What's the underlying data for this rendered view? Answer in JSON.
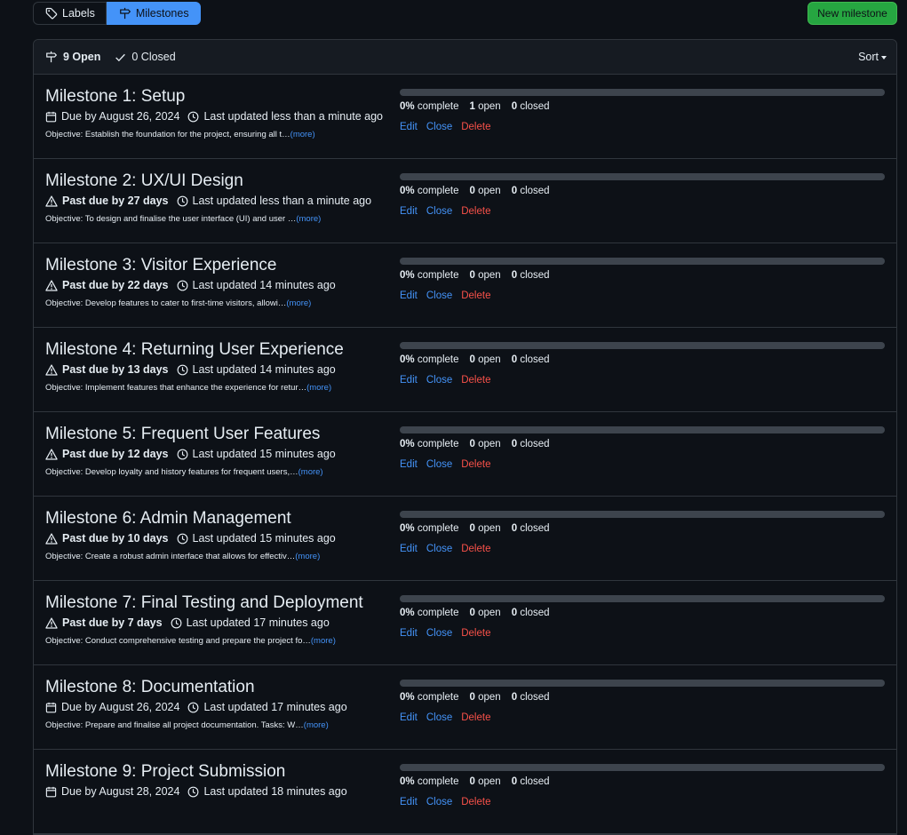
{
  "subnav": {
    "labels": "Labels",
    "milestones": "Milestones"
  },
  "new_milestone": "New milestone",
  "header": {
    "open_count": "9 Open",
    "closed_count": "0 Closed",
    "sort": "Sort"
  },
  "colors": {
    "accent": "#4493f8",
    "danger": "#f85149",
    "success": "#26a641"
  },
  "milestones": [
    {
      "title": "Milestone 1: Setup",
      "due_icon": "calendar-icon",
      "due_bold": "",
      "due_text": "Due by August 26, 2024",
      "updated": "Last updated less than a minute ago",
      "desc": "Objective: Establish the foundation for the project, ensuring all t…",
      "more": "(more)",
      "pct": "0%",
      "pct_label": "complete",
      "open": "1",
      "open_label": "open",
      "closed": "0",
      "closed_label": "closed",
      "progress": 0,
      "edit": "Edit",
      "close": "Close",
      "delete": "Delete"
    },
    {
      "title": "Milestone 2: UX/UI Design",
      "due_icon": "alert-icon",
      "due_bold": "Past due by 27 days",
      "due_text": "",
      "updated": "Last updated less than a minute ago",
      "desc": "Objective: To design and finalise the user interface (UI) and user …",
      "more": "(more)",
      "pct": "0%",
      "pct_label": "complete",
      "open": "0",
      "open_label": "open",
      "closed": "0",
      "closed_label": "closed",
      "progress": 0,
      "edit": "Edit",
      "close": "Close",
      "delete": "Delete"
    },
    {
      "title": "Milestone 3: Visitor Experience",
      "due_icon": "alert-icon",
      "due_bold": "Past due by 22 days",
      "due_text": "",
      "updated": "Last updated 14 minutes ago",
      "desc": "Objective: Develop features to cater to first-time visitors, allowi…",
      "more": "(more)",
      "pct": "0%",
      "pct_label": "complete",
      "open": "0",
      "open_label": "open",
      "closed": "0",
      "closed_label": "closed",
      "progress": 0,
      "edit": "Edit",
      "close": "Close",
      "delete": "Delete"
    },
    {
      "title": "Milestone 4: Returning User Experience",
      "due_icon": "alert-icon",
      "due_bold": "Past due by 13 days",
      "due_text": "",
      "updated": "Last updated 14 minutes ago",
      "desc": "Objective: Implement features that enhance the experience for retur…",
      "more": "(more)",
      "pct": "0%",
      "pct_label": "complete",
      "open": "0",
      "open_label": "open",
      "closed": "0",
      "closed_label": "closed",
      "progress": 0,
      "edit": "Edit",
      "close": "Close",
      "delete": "Delete"
    },
    {
      "title": "Milestone 5: Frequent User Features",
      "due_icon": "alert-icon",
      "due_bold": "Past due by 12 days",
      "due_text": "",
      "updated": "Last updated 15 minutes ago",
      "desc": "Objective: Develop loyalty and history features for frequent users,…",
      "more": "(more)",
      "pct": "0%",
      "pct_label": "complete",
      "open": "0",
      "open_label": "open",
      "closed": "0",
      "closed_label": "closed",
      "progress": 0,
      "edit": "Edit",
      "close": "Close",
      "delete": "Delete"
    },
    {
      "title": "Milestone 6: Admin Management",
      "due_icon": "alert-icon",
      "due_bold": "Past due by 10 days",
      "due_text": "",
      "updated": "Last updated 15 minutes ago",
      "desc": "Objective: Create a robust admin interface that allows for effectiv…",
      "more": "(more)",
      "pct": "0%",
      "pct_label": "complete",
      "open": "0",
      "open_label": "open",
      "closed": "0",
      "closed_label": "closed",
      "progress": 0,
      "edit": "Edit",
      "close": "Close",
      "delete": "Delete"
    },
    {
      "title": "Milestone 7: Final Testing and Deployment",
      "due_icon": "alert-icon",
      "due_bold": "Past due by 7 days",
      "due_text": "",
      "updated": "Last updated 17 minutes ago",
      "desc": "Objective: Conduct comprehensive testing and prepare the project fo…",
      "more": "(more)",
      "pct": "0%",
      "pct_label": "complete",
      "open": "0",
      "open_label": "open",
      "closed": "0",
      "closed_label": "closed",
      "progress": 0,
      "edit": "Edit",
      "close": "Close",
      "delete": "Delete"
    },
    {
      "title": "Milestone 8: Documentation",
      "due_icon": "calendar-icon",
      "due_bold": "",
      "due_text": "Due by August 26, 2024",
      "updated": "Last updated 17 minutes ago",
      "desc": "Objective: Prepare and finalise all project documentation. Tasks: W…",
      "more": "(more)",
      "pct": "0%",
      "pct_label": "complete",
      "open": "0",
      "open_label": "open",
      "closed": "0",
      "closed_label": "closed",
      "progress": 0,
      "edit": "Edit",
      "close": "Close",
      "delete": "Delete"
    },
    {
      "title": "Milestone 9: Project Submission",
      "due_icon": "calendar-icon",
      "due_bold": "",
      "due_text": "Due by August 28, 2024",
      "updated": "Last updated 18 minutes ago",
      "desc": "",
      "more": "",
      "pct": "0%",
      "pct_label": "complete",
      "open": "0",
      "open_label": "open",
      "closed": "0",
      "closed_label": "closed",
      "progress": 0,
      "edit": "Edit",
      "close": "Close",
      "delete": "Delete"
    }
  ]
}
